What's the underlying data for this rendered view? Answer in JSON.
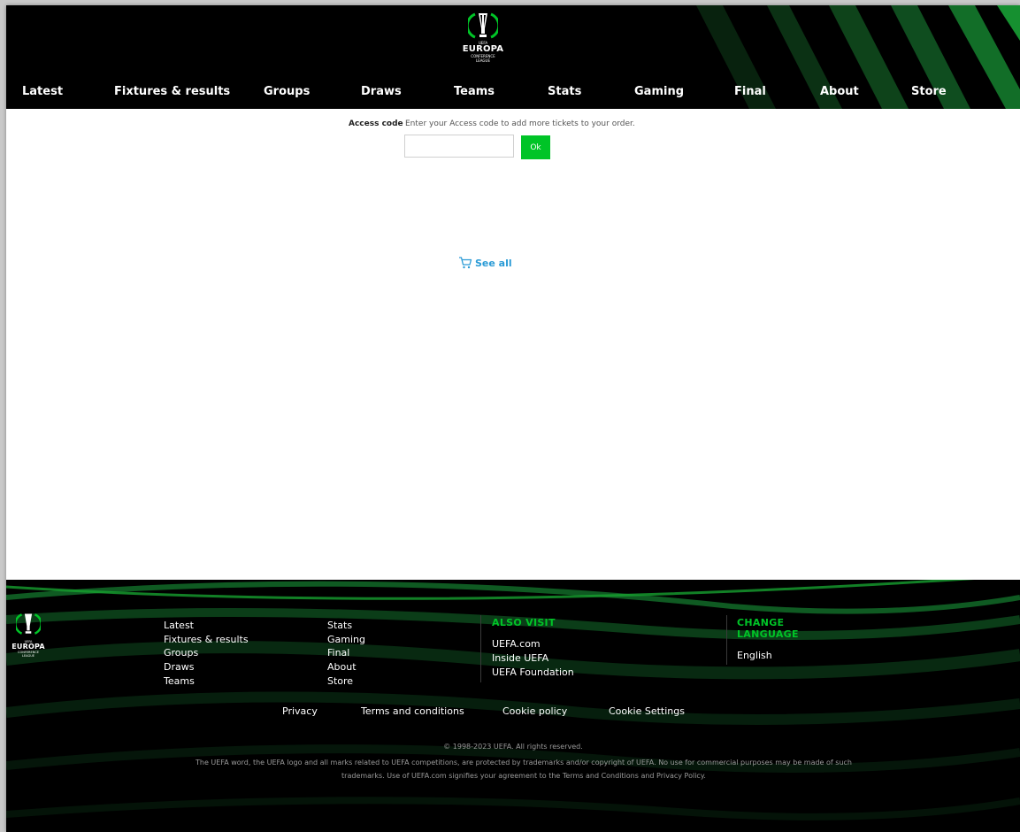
{
  "brand": {
    "logo_word": "EUROPA",
    "logo_sub1": "CONFERENCE",
    "logo_sub2": "LEAGUE",
    "logo_top": "UEFA"
  },
  "colors": {
    "accent_green": "#00c427",
    "header_bg": "#000000",
    "link_blue": "#2a9bd6"
  },
  "nav": {
    "items": [
      {
        "label": "Latest"
      },
      {
        "label": "Fixtures & results"
      },
      {
        "label": "Groups"
      },
      {
        "label": "Draws"
      },
      {
        "label": "Teams"
      },
      {
        "label": "Stats"
      },
      {
        "label": "Gaming"
      },
      {
        "label": "Final"
      },
      {
        "label": "About"
      },
      {
        "label": "Store"
      }
    ]
  },
  "access": {
    "label": "Access code",
    "hint": "Enter your Access code to add more tickets to your order.",
    "input_value": "",
    "ok_label": "Ok"
  },
  "cart": {
    "see_all_label": "See all",
    "icon": "cart-icon"
  },
  "footer": {
    "col1": [
      "Latest",
      "Fixtures & results",
      "Groups",
      "Draws",
      "Teams"
    ],
    "col2": [
      "Stats",
      "Gaming",
      "Final",
      "About",
      "Store"
    ],
    "also_visit": {
      "heading": "ALSO VISIT",
      "links": [
        "UEFA.com",
        "Inside UEFA",
        "UEFA Foundation"
      ]
    },
    "language": {
      "heading_line1": "CHANGE",
      "heading_line2": "LANGUAGE",
      "current": "English"
    },
    "legal_links": [
      "Privacy",
      "Terms and conditions",
      "Cookie policy",
      "Cookie Settings"
    ],
    "copyright": "© 1998-2023 UEFA. All rights reserved.",
    "disclaimer": "The UEFA word, the UEFA logo and all marks related to UEFA competitions, are protected by trademarks and/or copyright of UEFA. No use for commercial purposes may be made of such trademarks. Use of UEFA.com signifies your agreement to the Terms and Conditions and Privacy Policy."
  }
}
